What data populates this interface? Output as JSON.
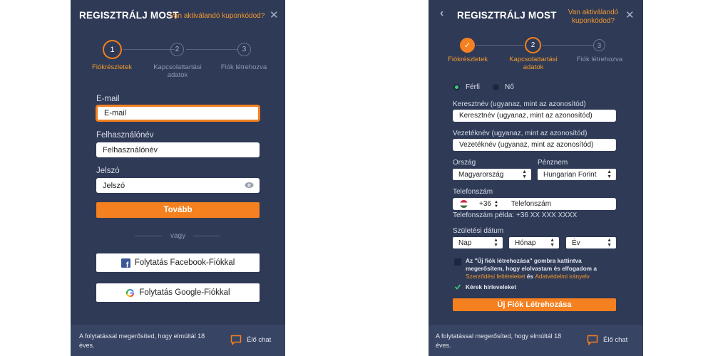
{
  "colors": {
    "panel_bg": "#2f3a56",
    "footer_bg": "#384463",
    "accent": "#f5801f",
    "link": "#f29a2e"
  },
  "left": {
    "title": "REGISZTRÁLJ MOST",
    "coupon": "Van aktiválandó kuponkódod?",
    "close_icon": "close-icon",
    "steps": [
      {
        "num": "1",
        "label": "Fiókrészletek"
      },
      {
        "num": "2",
        "label": "Kapcsolattartási adatok"
      },
      {
        "num": "3",
        "label": "Fiók létrehozva"
      }
    ],
    "email_label": "E-mail",
    "email_placeholder": "E-mail",
    "username_label": "Felhasználónév",
    "username_placeholder": "Felhasználónév",
    "password_label": "Jelszó",
    "password_placeholder": "Jelszó",
    "eye_icon": "eye-icon",
    "next_button": "Tovább",
    "or_text": "vagy",
    "facebook_button": "Folytatás Facebook-Fiókkal",
    "google_button": "Folytatás Google-Fiókkal",
    "footer_text": "A folytatással megerősíted, hogy elmúltál 18 éves.",
    "chat_label": "Élő chat"
  },
  "right": {
    "title": "REGISZTRÁLJ MOST",
    "coupon": "Van aktiválandó kuponkódod?",
    "back_icon": "chevron-left-icon",
    "steps": [
      {
        "num": "✓",
        "label": "Fiókrészletek"
      },
      {
        "num": "2",
        "label": "Kapcsolattartási adatok"
      },
      {
        "num": "3",
        "label": "Fiók létrehozva"
      }
    ],
    "gender_male": "Férfi",
    "gender_female": "Nő",
    "firstname_label": "Keresztnév (ugyanaz, mint az azonosítód)",
    "firstname_placeholder": "Keresztnév (ugyanaz, mint az azonosítód)",
    "lastname_label": "Vezetéknév (ugyanaz, mint az azonosítód)",
    "lastname_placeholder": "Vezetéknév (ugyanaz, mint az azonosítód)",
    "country_label": "Ország",
    "country_value": "Magyarország",
    "currency_label": "Pénznem",
    "currency_value": "Hungarian Forint",
    "phone_label": "Telefonszám",
    "phone_code": "+36",
    "phone_placeholder": "Telefonszám",
    "phone_example": "Telefonszám példa: +36 XX XXX XXXX",
    "dob_label": "Születési dátum",
    "dob_day": "Nap",
    "dob_month": "Hónap",
    "dob_year": "Év",
    "legal_a": "Az \"Új fiók létrehozása\" gombra kattintva megerősítem, hogy elolvastam és elfogadom a ",
    "legal_link1": "Szerződési feltételeket",
    "legal_and": " és ",
    "legal_link2": "Adatvédelmi irányelv",
    "newsletter_label": "Kérek hírleveleket",
    "create_button": "Új Fiók Létrehozása",
    "footer_text": "A folytatással megerősíted, hogy elmúltál 18 éves.",
    "chat_label": "Élő chat"
  }
}
